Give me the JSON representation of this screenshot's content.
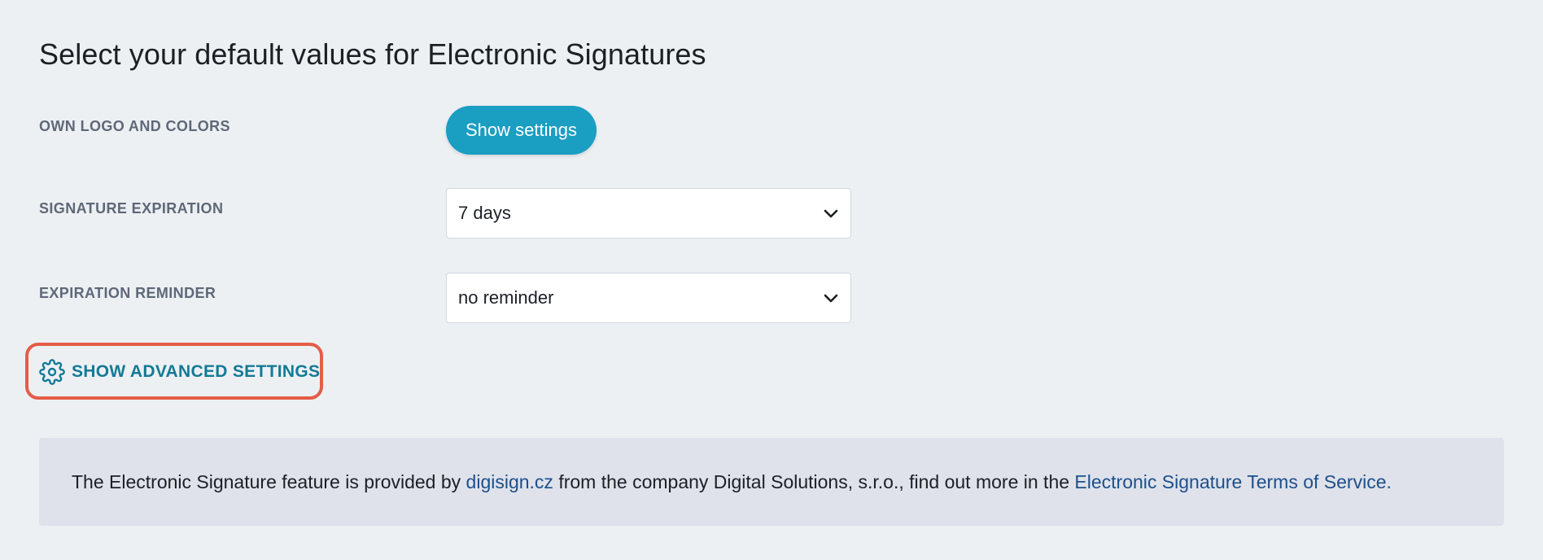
{
  "page": {
    "title": "Select your default values for Electronic Signatures"
  },
  "branding": {
    "label": "OWN LOGO AND COLORS",
    "button_label": "Show settings"
  },
  "expiration": {
    "label": "SIGNATURE EXPIRATION",
    "selected": "7 days"
  },
  "reminder": {
    "label": "EXPIRATION REMINDER",
    "selected": "no reminder"
  },
  "advanced": {
    "label": "SHOW ADVANCED SETTINGS",
    "icon": "gear-icon"
  },
  "info": {
    "text_before": "The Electronic Signature feature is provided by ",
    "provider_link": "digisign.cz",
    "text_middle": " from the company Digital Solutions, s.r.o., find out more in the ",
    "terms_link": "Electronic Signature Terms of Service."
  },
  "colors": {
    "accent": "#1a9ec2",
    "link": "#137a96",
    "highlight": "#e35d48",
    "background": "#edf0f3",
    "info_background": "#dfe2ea"
  }
}
